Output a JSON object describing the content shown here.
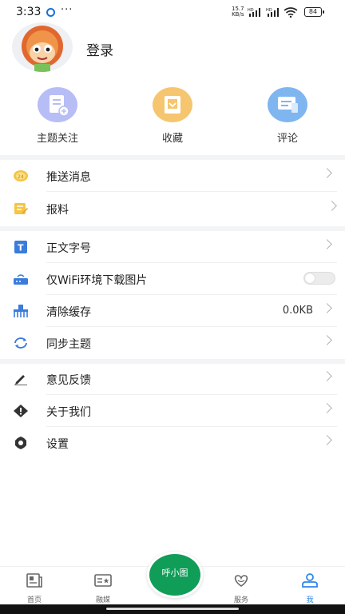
{
  "status_bar": {
    "time": "3:33",
    "more": "···",
    "speed_top": "15.7",
    "speed_bottom": "KB/s",
    "network1": "HD",
    "network2": "HD",
    "battery": "84"
  },
  "profile": {
    "login_label": "登录"
  },
  "quick_actions": [
    {
      "label": "主题关注",
      "color": "#b7bdf5"
    },
    {
      "label": "收藏",
      "color": "#f6c56f"
    },
    {
      "label": "评论",
      "color": "#7fb6ef"
    }
  ],
  "menu": {
    "push": {
      "label": "推送消息"
    },
    "report": {
      "label": "报料"
    },
    "font_size": {
      "label": "正文字号"
    },
    "wifi_images": {
      "label": "仅WiFi环境下载图片"
    },
    "clear_cache": {
      "label": "清除缓存",
      "value": "0.0KB"
    },
    "sync_topics": {
      "label": "同步主题"
    },
    "feedback": {
      "label": "意见反馈"
    },
    "about": {
      "label": "关于我们"
    },
    "settings": {
      "label": "设置"
    }
  },
  "bottom_nav": {
    "home": "首页",
    "media": "融媒",
    "center": "呼小图",
    "services": "服务",
    "me": "我",
    "active_color": "#2f86e8"
  }
}
